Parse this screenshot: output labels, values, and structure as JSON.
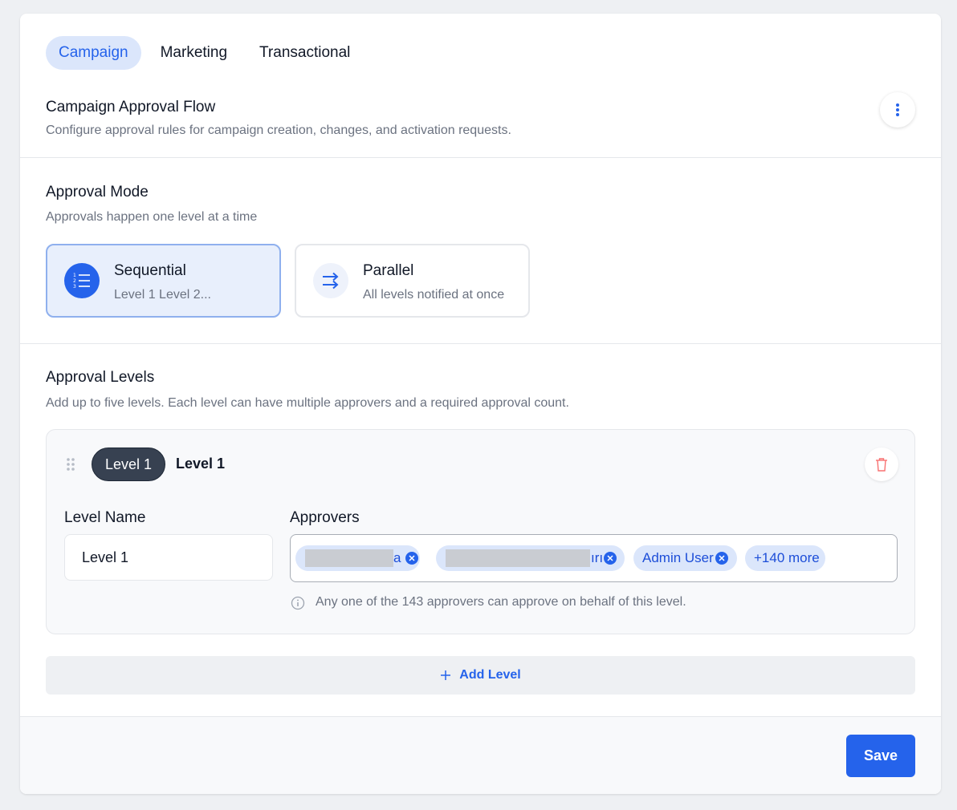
{
  "tabs": [
    {
      "label": "Campaign",
      "active": true
    },
    {
      "label": "Marketing",
      "active": false
    },
    {
      "label": "Transactional",
      "active": false
    }
  ],
  "header": {
    "title": "Campaign Approval Flow",
    "subtitle": "Configure approval rules for campaign creation, changes, and activation requests.",
    "menu_icon": "vertical-dots-icon"
  },
  "approval_mode": {
    "title": "Approval Mode",
    "subtitle": "Approvals happen one level at a time",
    "options": [
      {
        "name": "Sequential",
        "description": "Level 1 Level 2...",
        "icon": "ordered-list-icon",
        "selected": true
      },
      {
        "name": "Parallel",
        "description": "All levels notified at once",
        "icon": "parallel-arrows-icon",
        "selected": false
      }
    ]
  },
  "approval_levels": {
    "title": "Approval Levels",
    "subtitle": "Add up to five levels. Each level can have multiple approvers and a required approval count.",
    "levels": [
      {
        "badge": "Level 1",
        "label": "Level 1",
        "name_field_label": "Level Name",
        "name_value": "Level 1",
        "approvers_label": "Approvers",
        "approvers": [
          {
            "label": "a",
            "redacted": true
          },
          {
            "label": "ırı",
            "redacted": true
          },
          {
            "label": "Admin User",
            "redacted": false
          }
        ],
        "more_label": "+140 more",
        "hint": "Any one of the 143 approvers can approve on behalf of this level."
      }
    ],
    "add_label": "Add Level"
  },
  "footer": {
    "save_label": "Save"
  },
  "colors": {
    "accent": "#2563eb",
    "tab_active_bg": "#dbe6fb",
    "level_pill": "#374151",
    "trash": "#f87171"
  }
}
